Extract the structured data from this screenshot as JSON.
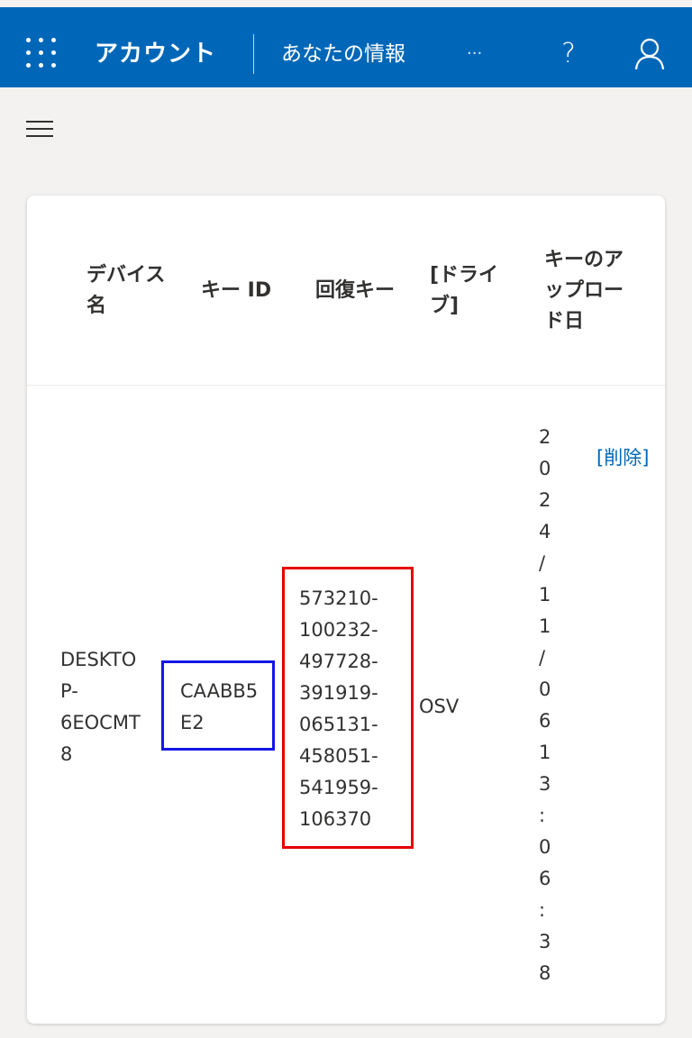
{
  "header": {
    "app_title": "アカウント",
    "section_title": "あなたの情報",
    "more_label": "···",
    "help_label": "?"
  },
  "table": {
    "columns": [
      {
        "label_lines": [
          "デバイス",
          "名"
        ]
      },
      {
        "label_lines": [
          "キー ID"
        ]
      },
      {
        "label_lines": [
          "回復キー"
        ]
      },
      {
        "label_lines": [
          "[ドライ",
          "ブ]"
        ]
      },
      {
        "label_lines": [
          "キーのア",
          "ップロー",
          "ド日"
        ]
      }
    ],
    "row": {
      "device_name_lines": [
        "DESKTO",
        "P-",
        "6EOCMT",
        "8"
      ],
      "key_id_lines": [
        "CAABB5",
        "E2"
      ],
      "recovery_key_lines": [
        "573210-",
        "100232-",
        "497728-",
        "391919-",
        "065131-",
        "458051-",
        "541959-",
        "106370"
      ],
      "drive": "OSV",
      "upload_date_chars": [
        "2",
        "0",
        "2",
        "4",
        "/",
        "1",
        "1",
        "/",
        "0",
        "6",
        "1",
        "3",
        ":",
        "0",
        "6",
        ":",
        "3",
        "8"
      ],
      "delete_label": "[削除]"
    }
  },
  "colors": {
    "accent": "#0067b8",
    "highlight_key_id": "#1616e6",
    "highlight_recovery_key": "#e60000"
  }
}
